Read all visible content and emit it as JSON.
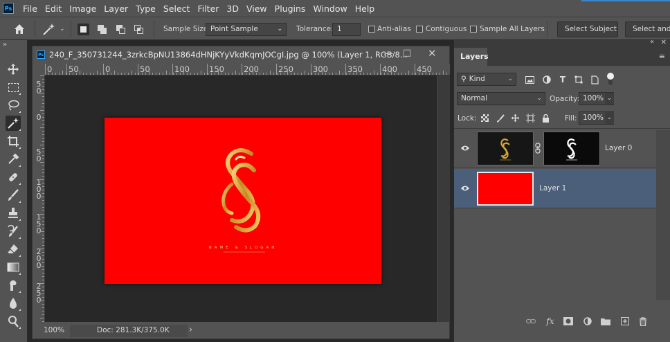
{
  "app": {
    "logo_text": "Ps",
    "menu": [
      "File",
      "Edit",
      "Image",
      "Layer",
      "Type",
      "Select",
      "Filter",
      "3D",
      "View",
      "Plugins",
      "Window",
      "Help"
    ]
  },
  "options": {
    "sample_size_label": "Sample Size:",
    "sample_size_value": "Point Sample",
    "tolerance_label": "Tolerance:",
    "tolerance_value": "1",
    "antialias_label": "Anti-alias",
    "contiguous_label": "Contiguous",
    "sample_all_label": "Sample All Layers",
    "select_subject_label": "Select Subject",
    "select_and_mask_label": "Select and M"
  },
  "document": {
    "title": "240_F_350731244_3zrkcBpNU13864dHNjKYyVkdKqmJOCgI.jpg @ 100% (Layer 1, RGB/8...",
    "ruler_h": [
      "0",
      "50",
      "0",
      "50",
      "100",
      "150",
      "200",
      "250",
      "300",
      "350",
      "400",
      "450"
    ],
    "ruler_v": [
      "5\n0",
      "0",
      "5\n0",
      "1\n0\n0",
      "1\n5\n0",
      "2\n0\n0",
      "2\n5\n0"
    ],
    "artwork_caption": "NAME & SLOGAN",
    "artwork_color": "#ff0000",
    "logo_gold": "#d4a437",
    "zoom": "100%",
    "doc_size": "Doc: 281.3K/375.0K"
  },
  "layers_panel": {
    "tab": "Layers",
    "filter_kind": "Kind",
    "blend_mode": "Normal",
    "opacity_label": "Opacity:",
    "opacity_value": "100%",
    "lock_label": "Lock:",
    "fill_label": "Fill:",
    "fill_value": "100%",
    "layers": [
      {
        "name": "Layer 0",
        "visible": true,
        "selected": false,
        "has_mask": true
      },
      {
        "name": "Layer 1",
        "visible": true,
        "selected": true,
        "has_mask": false
      }
    ],
    "selected_row_color": "#4b5f7a"
  }
}
